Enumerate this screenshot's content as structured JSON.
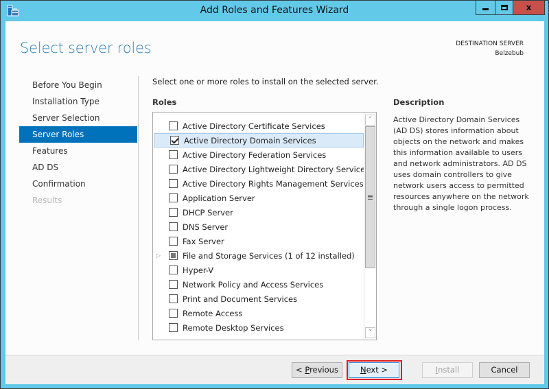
{
  "window": {
    "title": "Add Roles and Features Wizard",
    "app_icon": "server-manager-icon",
    "controls": {
      "minimize": "minimize-icon",
      "maximize": "maximize-icon",
      "close": "close-icon",
      "close_glyph": "x"
    }
  },
  "page": {
    "title": "Select server roles",
    "destination_label": "DESTINATION SERVER",
    "destination_server": "Belzebub"
  },
  "nav": {
    "items": [
      {
        "label": "Before You Begin",
        "state": "normal"
      },
      {
        "label": "Installation Type",
        "state": "normal"
      },
      {
        "label": "Server Selection",
        "state": "normal"
      },
      {
        "label": "Server Roles",
        "state": "selected"
      },
      {
        "label": "Features",
        "state": "normal"
      },
      {
        "label": "AD DS",
        "state": "normal"
      },
      {
        "label": "Confirmation",
        "state": "normal"
      },
      {
        "label": "Results",
        "state": "disabled"
      }
    ]
  },
  "roles": {
    "instruction": "Select one or more roles to install on the selected server.",
    "header": "Roles",
    "items": [
      {
        "label": "Active Directory Certificate Services",
        "state": "unchecked",
        "selected": false,
        "expandable": false
      },
      {
        "label": "Active Directory Domain Services",
        "state": "checked",
        "selected": true,
        "expandable": false
      },
      {
        "label": "Active Directory Federation Services",
        "state": "unchecked",
        "selected": false,
        "expandable": false
      },
      {
        "label": "Active Directory Lightweight Directory Services",
        "state": "unchecked",
        "selected": false,
        "expandable": false
      },
      {
        "label": "Active Directory Rights Management Services",
        "state": "unchecked",
        "selected": false,
        "expandable": false
      },
      {
        "label": "Application Server",
        "state": "unchecked",
        "selected": false,
        "expandable": false
      },
      {
        "label": "DHCP Server",
        "state": "unchecked",
        "selected": false,
        "expandable": false
      },
      {
        "label": "DNS Server",
        "state": "unchecked",
        "selected": false,
        "expandable": false
      },
      {
        "label": "Fax Server",
        "state": "unchecked",
        "selected": false,
        "expandable": false
      },
      {
        "label": "File and Storage Services (1 of 12 installed)",
        "state": "partial",
        "selected": false,
        "expandable": true
      },
      {
        "label": "Hyper-V",
        "state": "unchecked",
        "selected": false,
        "expandable": false
      },
      {
        "label": "Network Policy and Access Services",
        "state": "unchecked",
        "selected": false,
        "expandable": false
      },
      {
        "label": "Print and Document Services",
        "state": "unchecked",
        "selected": false,
        "expandable": false
      },
      {
        "label": "Remote Access",
        "state": "unchecked",
        "selected": false,
        "expandable": false
      },
      {
        "label": "Remote Desktop Services",
        "state": "unchecked",
        "selected": false,
        "expandable": false
      }
    ],
    "scrollbar": {
      "position_fraction": 0.0,
      "visible_fraction": 0.71,
      "up_glyph": "˄",
      "down_glyph": "˅"
    }
  },
  "description": {
    "header": "Description",
    "text": "Active Directory Domain Services (AD DS) stores information about objects on the network and makes this information available to users and network administrators. AD DS uses domain controllers to give network users access to permitted resources anywhere on the network through a single logon process."
  },
  "buttons": {
    "previous": {
      "prefix": "< ",
      "accel": "P",
      "rest": "revious",
      "enabled": true
    },
    "next": {
      "accel": "N",
      "rest": "ext >",
      "enabled": true,
      "focused": true,
      "highlighted": true
    },
    "install": {
      "accel": "I",
      "rest": "nstall",
      "enabled": false
    },
    "cancel": {
      "label": "Cancel",
      "enabled": true
    }
  },
  "colors": {
    "frame": "#63c9e9",
    "accent": "#0072bc",
    "title_text": "#2a7fb3",
    "close_button": "#c7504b",
    "highlight_box": "#e21b23"
  }
}
